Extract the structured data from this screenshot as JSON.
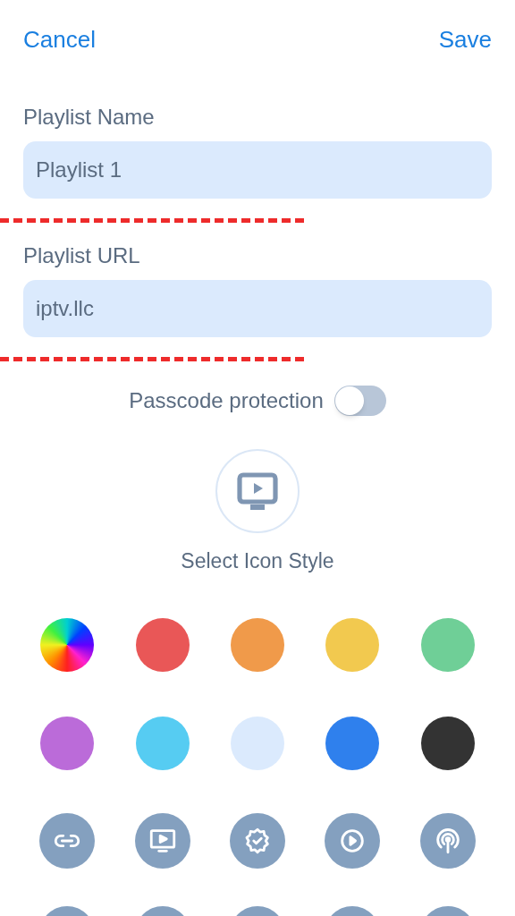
{
  "header": {
    "cancel": "Cancel",
    "save": "Save"
  },
  "fields": [
    {
      "label": "Playlist Name",
      "value": "Playlist 1"
    },
    {
      "label": "Playlist URL",
      "value": "iptv.llc"
    }
  ],
  "passcode": {
    "label": "Passcode protection",
    "on": false
  },
  "icon_style": {
    "label": "Select Icon Style"
  },
  "colors": [
    {
      "kind": "spectrum"
    },
    {
      "kind": "solid",
      "color": "#e95757"
    },
    {
      "kind": "solid",
      "color": "#f09a4a"
    },
    {
      "kind": "solid",
      "color": "#f2c94f"
    },
    {
      "kind": "solid",
      "color": "#6fcf97"
    },
    {
      "kind": "solid",
      "color": "#bb6bd9"
    },
    {
      "kind": "solid",
      "color": "#56ccf2"
    },
    {
      "kind": "solid",
      "color": "#dbeafd"
    },
    {
      "kind": "solid",
      "color": "#2f80ed"
    },
    {
      "kind": "solid",
      "color": "#333333"
    }
  ],
  "icons": [
    {
      "kind": "link"
    },
    {
      "kind": "tv"
    },
    {
      "kind": "badge"
    },
    {
      "kind": "play"
    },
    {
      "kind": "broadcast"
    },
    {
      "kind": "hidden"
    },
    {
      "kind": "hidden"
    },
    {
      "kind": "hidden"
    },
    {
      "kind": "hidden"
    },
    {
      "kind": "hidden"
    }
  ]
}
